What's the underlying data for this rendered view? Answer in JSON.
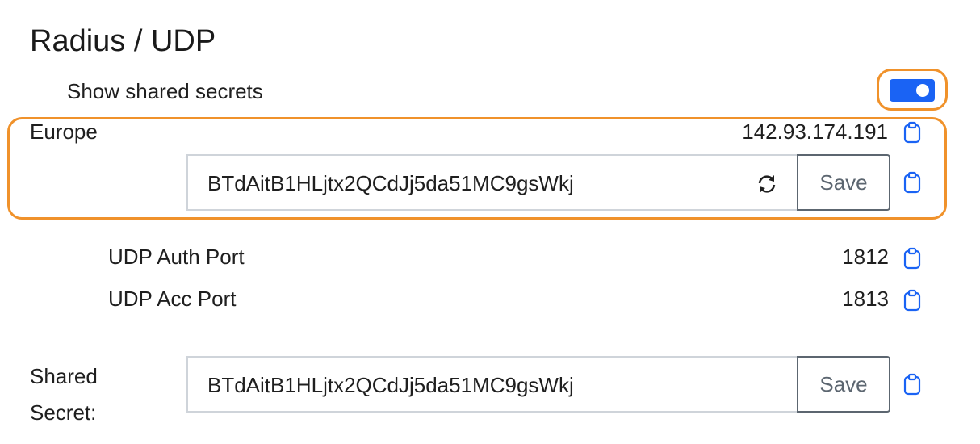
{
  "page": {
    "title": "Radius / UDP"
  },
  "toggle": {
    "label": "Show shared secrets",
    "state": true,
    "color": "#1a63f4"
  },
  "region": {
    "name": "Europe",
    "ip": "142.93.174.191",
    "secret_value": "BTdAitB1HLjtx2QCdJj5da51MC9gsWkj",
    "save_label": "Save"
  },
  "ports": [
    {
      "label": "UDP Auth Port",
      "value": "1812"
    },
    {
      "label": "UDP Acc Port",
      "value": "1813"
    }
  ],
  "shared_secret": {
    "label_line1": "Shared",
    "label_line2": "Secret:",
    "value": "BTdAitB1HLjtx2QCdJj5da51MC9gsWkj",
    "save_label": "Save"
  },
  "icons": {
    "clipboard": "clipboard-icon",
    "refresh": "refresh-icon"
  },
  "colors": {
    "highlight": "#f0922b",
    "accent": "#1a63f4"
  }
}
